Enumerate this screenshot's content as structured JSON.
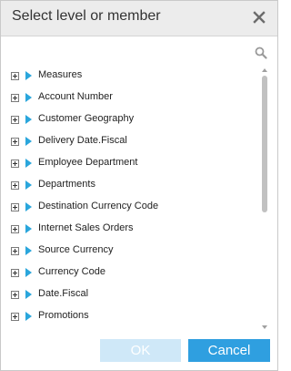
{
  "dialog": {
    "title": "Select level or member",
    "close_icon": "close-icon",
    "search_icon": "search-icon"
  },
  "tree": {
    "item_icon": "cube-triangle-icon",
    "expander_icon": "plus-expand-icon",
    "items": [
      {
        "label": "Measures"
      },
      {
        "label": "Account Number"
      },
      {
        "label": "Customer Geography"
      },
      {
        "label": "Delivery Date.Fiscal"
      },
      {
        "label": "Employee Department"
      },
      {
        "label": "Departments"
      },
      {
        "label": "Destination Currency Code"
      },
      {
        "label": "Internet Sales Orders"
      },
      {
        "label": "Source Currency"
      },
      {
        "label": "Currency Code"
      },
      {
        "label": "Date.Fiscal"
      },
      {
        "label": "Promotions"
      }
    ]
  },
  "footer": {
    "ok_label": "OK",
    "ok_enabled": false,
    "cancel_label": "Cancel"
  },
  "colors": {
    "accent": "#2f9fe0",
    "accent_disabled": "#cfe8f8",
    "tree_icon": "#2aa6dc",
    "titlebar": "#ececec"
  }
}
